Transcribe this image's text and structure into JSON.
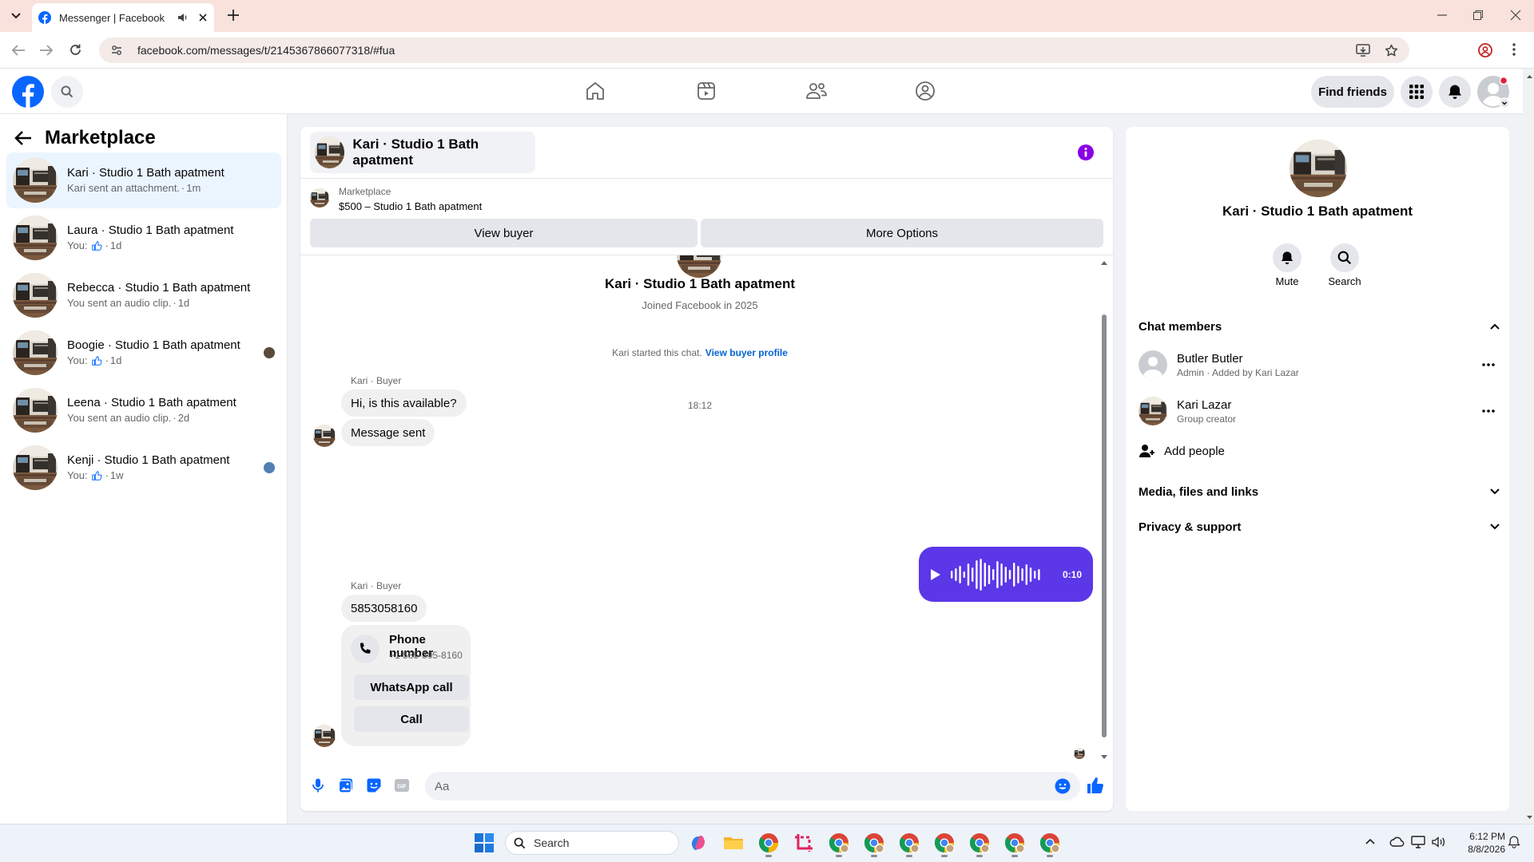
{
  "browser": {
    "tab_title": "Messenger | Facebook",
    "url": "facebook.com/messages/t/2145367866077318/#fua"
  },
  "header": {
    "find_friends": "Find friends"
  },
  "sidebar": {
    "title": "Marketplace",
    "conversations": [
      {
        "name": "Kari · Studio 1 Bath apatment",
        "preview": "Kari sent an attachment.",
        "time": "1m",
        "active": true
      },
      {
        "name": "Laura · Studio 1 Bath apatment",
        "preview": "You:",
        "time": "1d",
        "like": true
      },
      {
        "name": "Rebecca · Studio 1 Bath apatment",
        "preview": "You sent an audio clip.",
        "time": "1d"
      },
      {
        "name": "Boogie · Studio 1 Bath apatment",
        "preview": "You:",
        "time": "1d",
        "like": true
      },
      {
        "name": "Leena · Studio 1 Bath apatment",
        "preview": "You sent an audio clip.",
        "time": "2d"
      },
      {
        "name": "Kenji · Studio 1 Bath apatment",
        "preview": "You:",
        "time": "1w",
        "like": true
      }
    ]
  },
  "chat": {
    "title": "Kari · Studio 1 Bath apatment",
    "listing_source": "Marketplace",
    "listing_title": "$500 – Studio 1 Bath apatment",
    "view_buyer": "View buyer",
    "more_options": "More Options",
    "profile_name": "Kari · Studio 1 Bath apatment",
    "joined": "Joined Facebook in 2025",
    "started_text": "Kari started this chat.",
    "view_buyer_profile": "View buyer profile",
    "sender_label": "Kari · Buyer",
    "msg1": "Hi, is this available?",
    "msg2": "Message sent",
    "timestamp": "18:12",
    "audio_duration": "0:10",
    "msg3": "5853058160",
    "phone_card_title": "Phone number",
    "phone_card_number": "+1 585-305-8160",
    "whatsapp_call": "WhatsApp call",
    "call": "Call",
    "input_placeholder": "Aa"
  },
  "details": {
    "name": "Kari · Studio 1 Bath apatment",
    "mute": "Mute",
    "search": "Search",
    "chat_members": "Chat members",
    "members": [
      {
        "name": "Butler Butler",
        "role": "Admin · Added by Kari Lazar"
      },
      {
        "name": "Kari Lazar",
        "role": "Group creator"
      }
    ],
    "add_people": "Add people",
    "media": "Media, files and links",
    "privacy": "Privacy & support"
  },
  "taskbar": {
    "search": "Search",
    "time": "6:12 PM",
    "date": "8/8/2026"
  },
  "colors": {
    "brand": "#0866ff",
    "messenger_purple": "#5b37e8",
    "info_purple": "#8a00e6",
    "active_row": "#ebf5ff",
    "link": "#0064d1"
  }
}
